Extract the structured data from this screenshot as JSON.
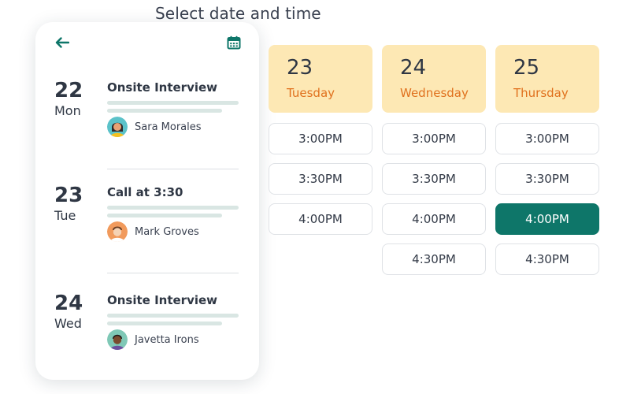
{
  "page": {
    "title": "Select date and time"
  },
  "phone": {
    "events": [
      {
        "day": "22",
        "dow": "Mon",
        "title": "Onsite Interview",
        "person": "Sara Morales"
      },
      {
        "day": "23",
        "dow": "Tue",
        "title": "Call at 3:30",
        "person": "Mark Groves"
      },
      {
        "day": "24",
        "dow": "Wed",
        "title": "Onsite Interview",
        "person": "Javetta Irons"
      }
    ]
  },
  "schedule": {
    "days": [
      {
        "num": "23",
        "name": "Tuesday",
        "slots": [
          "3:00PM",
          "3:30PM",
          "4:00PM"
        ]
      },
      {
        "num": "24",
        "name": "Wednesday",
        "slots": [
          "3:00PM",
          "3:30PM",
          "4:00PM",
          "4:30PM"
        ]
      },
      {
        "num": "25",
        "name": "Thursday",
        "slots": [
          "3:00PM",
          "3:30PM",
          "4:00PM",
          "4:30PM"
        ]
      }
    ],
    "selected_slot": "4:00PM",
    "selected_day": "25"
  },
  "colors": {
    "accent": "#0e7669",
    "date_card_bg": "#fde8b4",
    "weekday_text": "#e0711e",
    "skeleton": "#d9e6e3"
  },
  "icons": {
    "back": "arrow-left-icon",
    "calendar": "calendar-icon"
  }
}
